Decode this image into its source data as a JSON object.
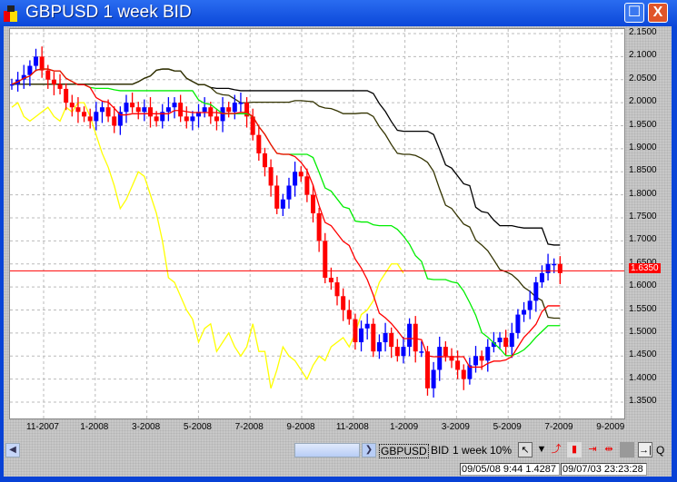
{
  "window": {
    "title": "GBPUSD 1 week BID",
    "maximize": "☐",
    "close": "X"
  },
  "colors": {
    "up": "#0000ff",
    "down": "#ff0000",
    "tenkan": "#ff0000",
    "kijun": "#00ee00",
    "chikou": "#ffff00",
    "spanA": "#333300",
    "spanB": "#000000",
    "last": "#ff0000"
  },
  "axis": {
    "y_ticks": [
      "2.1500",
      "2.1000",
      "2.0500",
      "2.0000",
      "1.9500",
      "1.9000",
      "1.8500",
      "1.8000",
      "1.7500",
      "1.7000",
      "1.6500",
      "1.6000",
      "1.5500",
      "1.5000",
      "1.4500",
      "1.4000",
      "1.3500"
    ],
    "x_ticks": [
      "11-2007",
      "1-2008",
      "3-2008",
      "5-2008",
      "7-2008",
      "9-2008",
      "11-2008",
      "1-2009",
      "3-2009",
      "5-2009",
      "7-2009",
      "9-2009"
    ]
  },
  "last_price": "1.6350",
  "toolbar": {
    "symbol": "GBPUSD",
    "side": "BID",
    "period": "1 week",
    "zoom": "10%",
    "q": "Q"
  },
  "status": {
    "cursor": "09/05/08 9:44 1.4287",
    "server_time": "09/07/03 23:23:28"
  },
  "chart_data": {
    "type": "candlestick",
    "ylim": [
      1.35,
      2.15
    ],
    "last": 1.635,
    "closes": [
      2.04,
      2.05,
      2.06,
      2.08,
      2.1,
      2.07,
      2.05,
      2.04,
      2.03,
      2.0,
      1.99,
      1.98,
      1.97,
      1.96,
      1.98,
      1.99,
      1.97,
      1.95,
      1.98,
      2.0,
      1.99,
      1.98,
      1.99,
      1.97,
      1.96,
      1.98,
      1.99,
      2.0,
      1.97,
      1.96,
      1.97,
      1.98,
      1.99,
      1.97,
      1.96,
      1.99,
      1.98,
      2.0,
      2.0,
      1.97,
      1.93,
      1.89,
      1.86,
      1.82,
      1.77,
      1.79,
      1.82,
      1.85,
      1.84,
      1.8,
      1.76,
      1.7,
      1.62,
      1.61,
      1.58,
      1.55,
      1.53,
      1.48,
      1.51,
      1.52,
      1.46,
      1.48,
      1.5,
      1.47,
      1.45,
      1.47,
      1.52,
      1.46,
      1.46,
      1.38,
      1.42,
      1.47,
      1.45,
      1.44,
      1.42,
      1.4,
      1.43,
      1.45,
      1.44,
      1.47,
      1.48,
      1.49,
      1.47,
      1.5,
      1.54,
      1.55,
      1.57,
      1.61,
      1.63,
      1.65,
      1.65,
      1.63
    ]
  }
}
